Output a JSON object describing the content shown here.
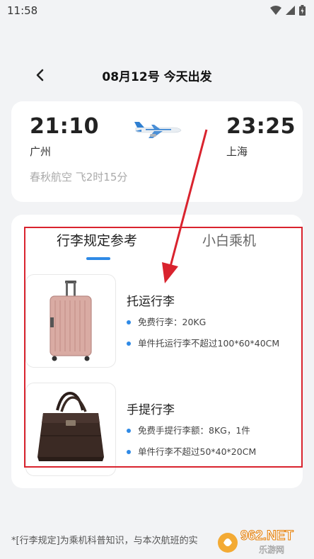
{
  "status_bar": {
    "time": "11:58"
  },
  "header": {
    "title": "08月12号 今天出发"
  },
  "flight": {
    "depart_time": "21:10",
    "depart_city": "广州",
    "arrive_time": "23:25",
    "arrive_city": "上海",
    "airline_info": "春秋航空 飞2时15分"
  },
  "tabs": [
    {
      "label": "行李规定参考",
      "active": true
    },
    {
      "label": "小白乘机",
      "active": false
    }
  ],
  "luggage": [
    {
      "title": "托运行李",
      "rules": [
        "免费行李：20KG",
        "单件托运行李不超过100*60*40CM"
      ]
    },
    {
      "title": "手提行李",
      "rules": [
        "免费手提行李额：8KG，1件",
        "单件行李不超过50*40*20CM"
      ]
    }
  ],
  "footnote": "*[行李规定]为乘机科普知识，与本次航班的实",
  "watermark": {
    "brand": "962.NET",
    "sub": "乐游网"
  },
  "colors": {
    "accent": "#2f8ae6",
    "annotation": "#d9232e",
    "background": "#f2f3f5"
  }
}
